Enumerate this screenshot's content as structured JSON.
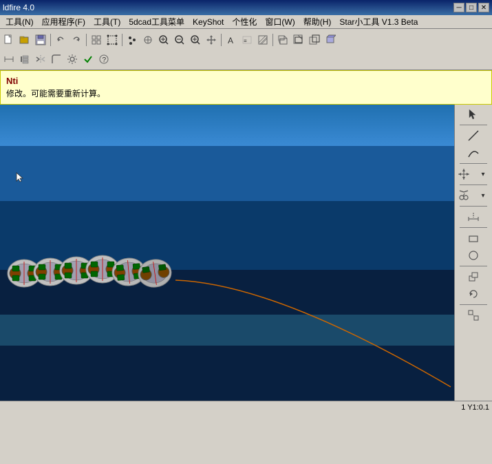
{
  "titleBar": {
    "title": "ldfire 4.0"
  },
  "menuBar": {
    "items": [
      {
        "label": "工具(N)",
        "id": "menu-tools"
      },
      {
        "label": "应用程序(F)",
        "id": "menu-app"
      },
      {
        "label": "工具(T)",
        "id": "menu-tools2"
      },
      {
        "label": "5dcad工具菜单",
        "id": "menu-5dcad"
      },
      {
        "label": "KeyShot",
        "id": "menu-keyshot"
      },
      {
        "label": "个性化",
        "id": "menu-personal"
      },
      {
        "label": "窗口(W)",
        "id": "menu-window"
      },
      {
        "label": "帮助(H)",
        "id": "menu-help"
      },
      {
        "label": "Star小工具 V1.3 Beta",
        "id": "menu-star"
      }
    ]
  },
  "notification": {
    "title": "Nti",
    "text": "修改。可能需要重新计算。"
  },
  "statusBar": {
    "coords": "1 Y1:0.1"
  },
  "rightPanel": {
    "buttons": [
      {
        "id": "rp-select",
        "icon": "↖"
      },
      {
        "id": "rp-line",
        "icon": "╱"
      },
      {
        "id": "rp-curve",
        "icon": "∿"
      },
      {
        "id": "rp-transform",
        "icon": "✣"
      },
      {
        "id": "rp-dim",
        "icon": "↔"
      },
      {
        "id": "rp-rect",
        "icon": "▭"
      },
      {
        "id": "rp-circle",
        "icon": "○"
      },
      {
        "id": "rp-move",
        "icon": "⊹"
      },
      {
        "id": "rp-rotate",
        "icon": "↻"
      },
      {
        "id": "rp-scale",
        "icon": "⇲"
      }
    ]
  }
}
